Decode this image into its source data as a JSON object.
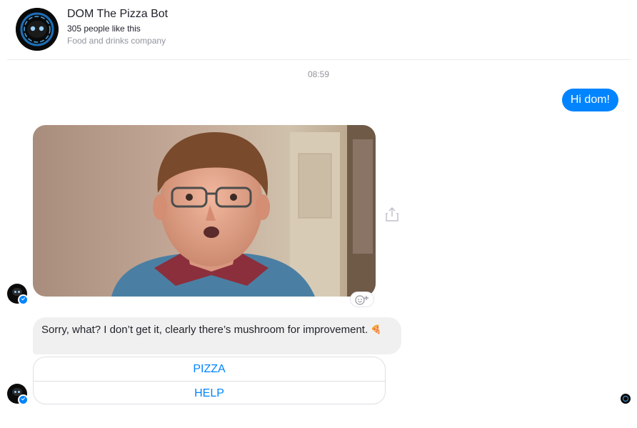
{
  "header": {
    "page_name": "DOM The Pizza Bot",
    "likes": "305 people like this",
    "category": "Food and drinks company"
  },
  "thread": {
    "timestamp": "08:59",
    "messages": [
      {
        "from": "user",
        "text": "Hi dom!"
      },
      {
        "from": "bot",
        "type": "gif",
        "image": "young man with glasses in a blue sweater making a surprised face"
      },
      {
        "from": "bot",
        "text": "Sorry, what? I don’t get it, clearly there’s mushroom for improvement.",
        "emoji": "🍕"
      }
    ],
    "quick_replies": [
      "PIZZA",
      "HELP"
    ]
  },
  "icons": {
    "share": "share-icon",
    "react": "add-reaction-icon",
    "badge": "messenger-badge-icon",
    "seen": "seen-avatar-icon"
  },
  "colors": {
    "accent": "#0084ff",
    "incoming_bubble": "#f1f0f0",
    "secondary_text": "#90949c"
  }
}
